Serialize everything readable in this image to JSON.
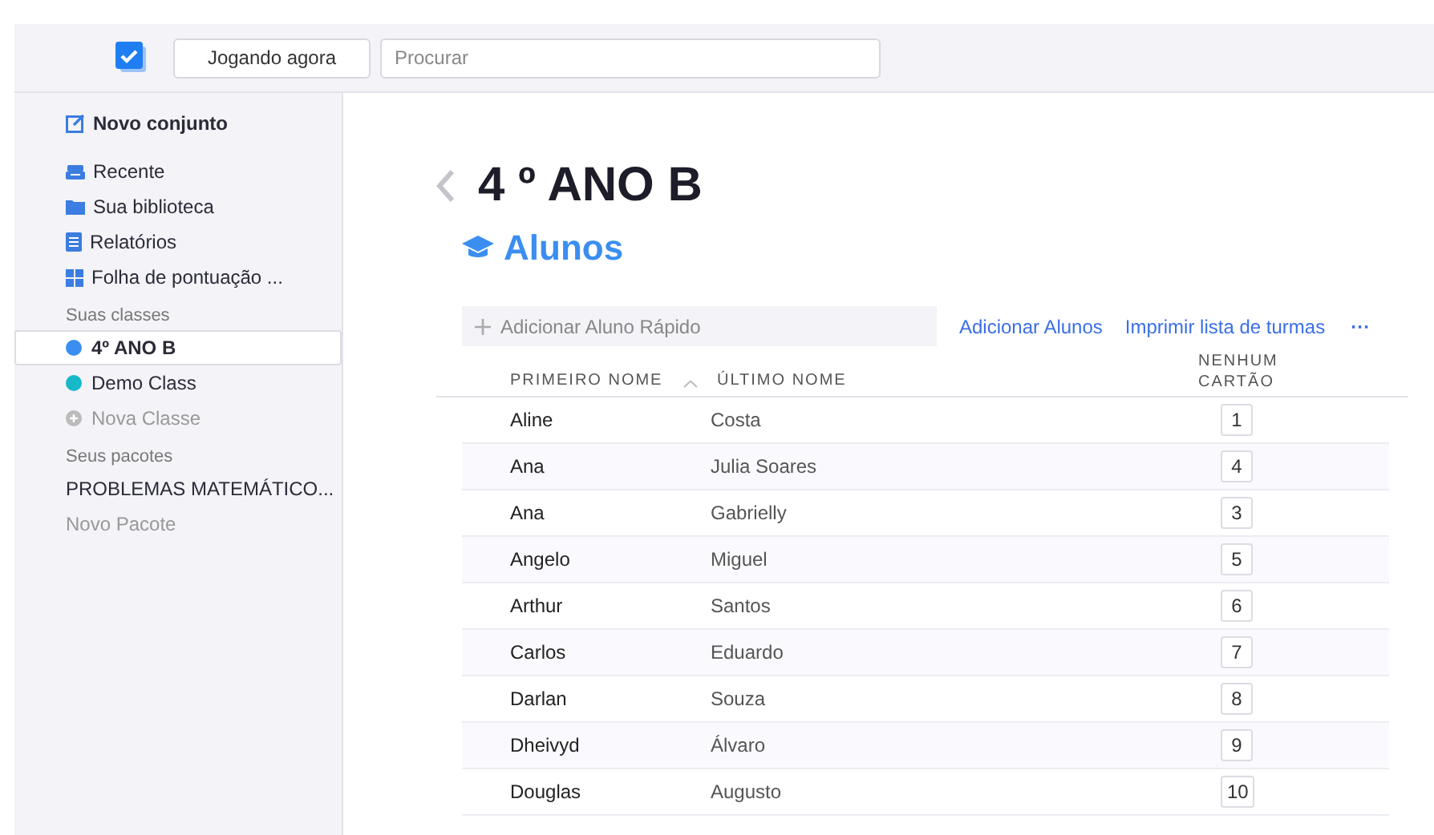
{
  "toolbar": {
    "now_playing_button": "Jogando agora",
    "search": {
      "placeholder": "Procurar"
    }
  },
  "sidebar": {
    "new_set": "Novo conjunto",
    "nav_items": [
      {
        "label": "Recente",
        "kind": "tray"
      },
      {
        "label": "Sua biblioteca",
        "kind": "folder"
      },
      {
        "label": "Relatórios",
        "kind": "report"
      },
      {
        "label": "Folha de pontuação ...",
        "kind": "grid"
      }
    ],
    "classes_heading": "Suas classes",
    "classes": [
      {
        "label": "4º ANO B",
        "color": "#3b8ef0",
        "selected": true
      },
      {
        "label": "Demo Class",
        "color": "#17b8c8",
        "selected": false
      }
    ],
    "new_class": "Nova Classe",
    "packages_heading": "Seus pacotes",
    "packages": [
      "PROBLEMAS MATEMÁTICO..."
    ],
    "new_package": "Novo Pacote"
  },
  "main": {
    "title": "4 º ANO B",
    "section": "Alunos",
    "quick_add": {
      "placeholder": "Adicionar Aluno Rápido"
    },
    "actions": [
      "Adicionar Alunos",
      "Imprimir lista de turmas"
    ],
    "more": "···",
    "table": {
      "columns": [
        "PRIMEIRO NOME",
        "ÚLTIMO NOME",
        "NENHUM CARTÃO"
      ],
      "rows": [
        [
          "Aline",
          "Costa",
          "1"
        ],
        [
          "Ana",
          "Julia Soares",
          "4"
        ],
        [
          "Ana",
          "Gabrielly",
          "3"
        ],
        [
          "Angelo",
          "Miguel",
          "5"
        ],
        [
          "Arthur",
          "Santos",
          "6"
        ],
        [
          "Carlos",
          "Eduardo",
          "7"
        ],
        [
          "Darlan",
          "Souza",
          "8"
        ],
        [
          "Dheivyd",
          "Álvaro",
          "9"
        ],
        [
          "Douglas",
          "Augusto",
          "10"
        ]
      ]
    }
  }
}
